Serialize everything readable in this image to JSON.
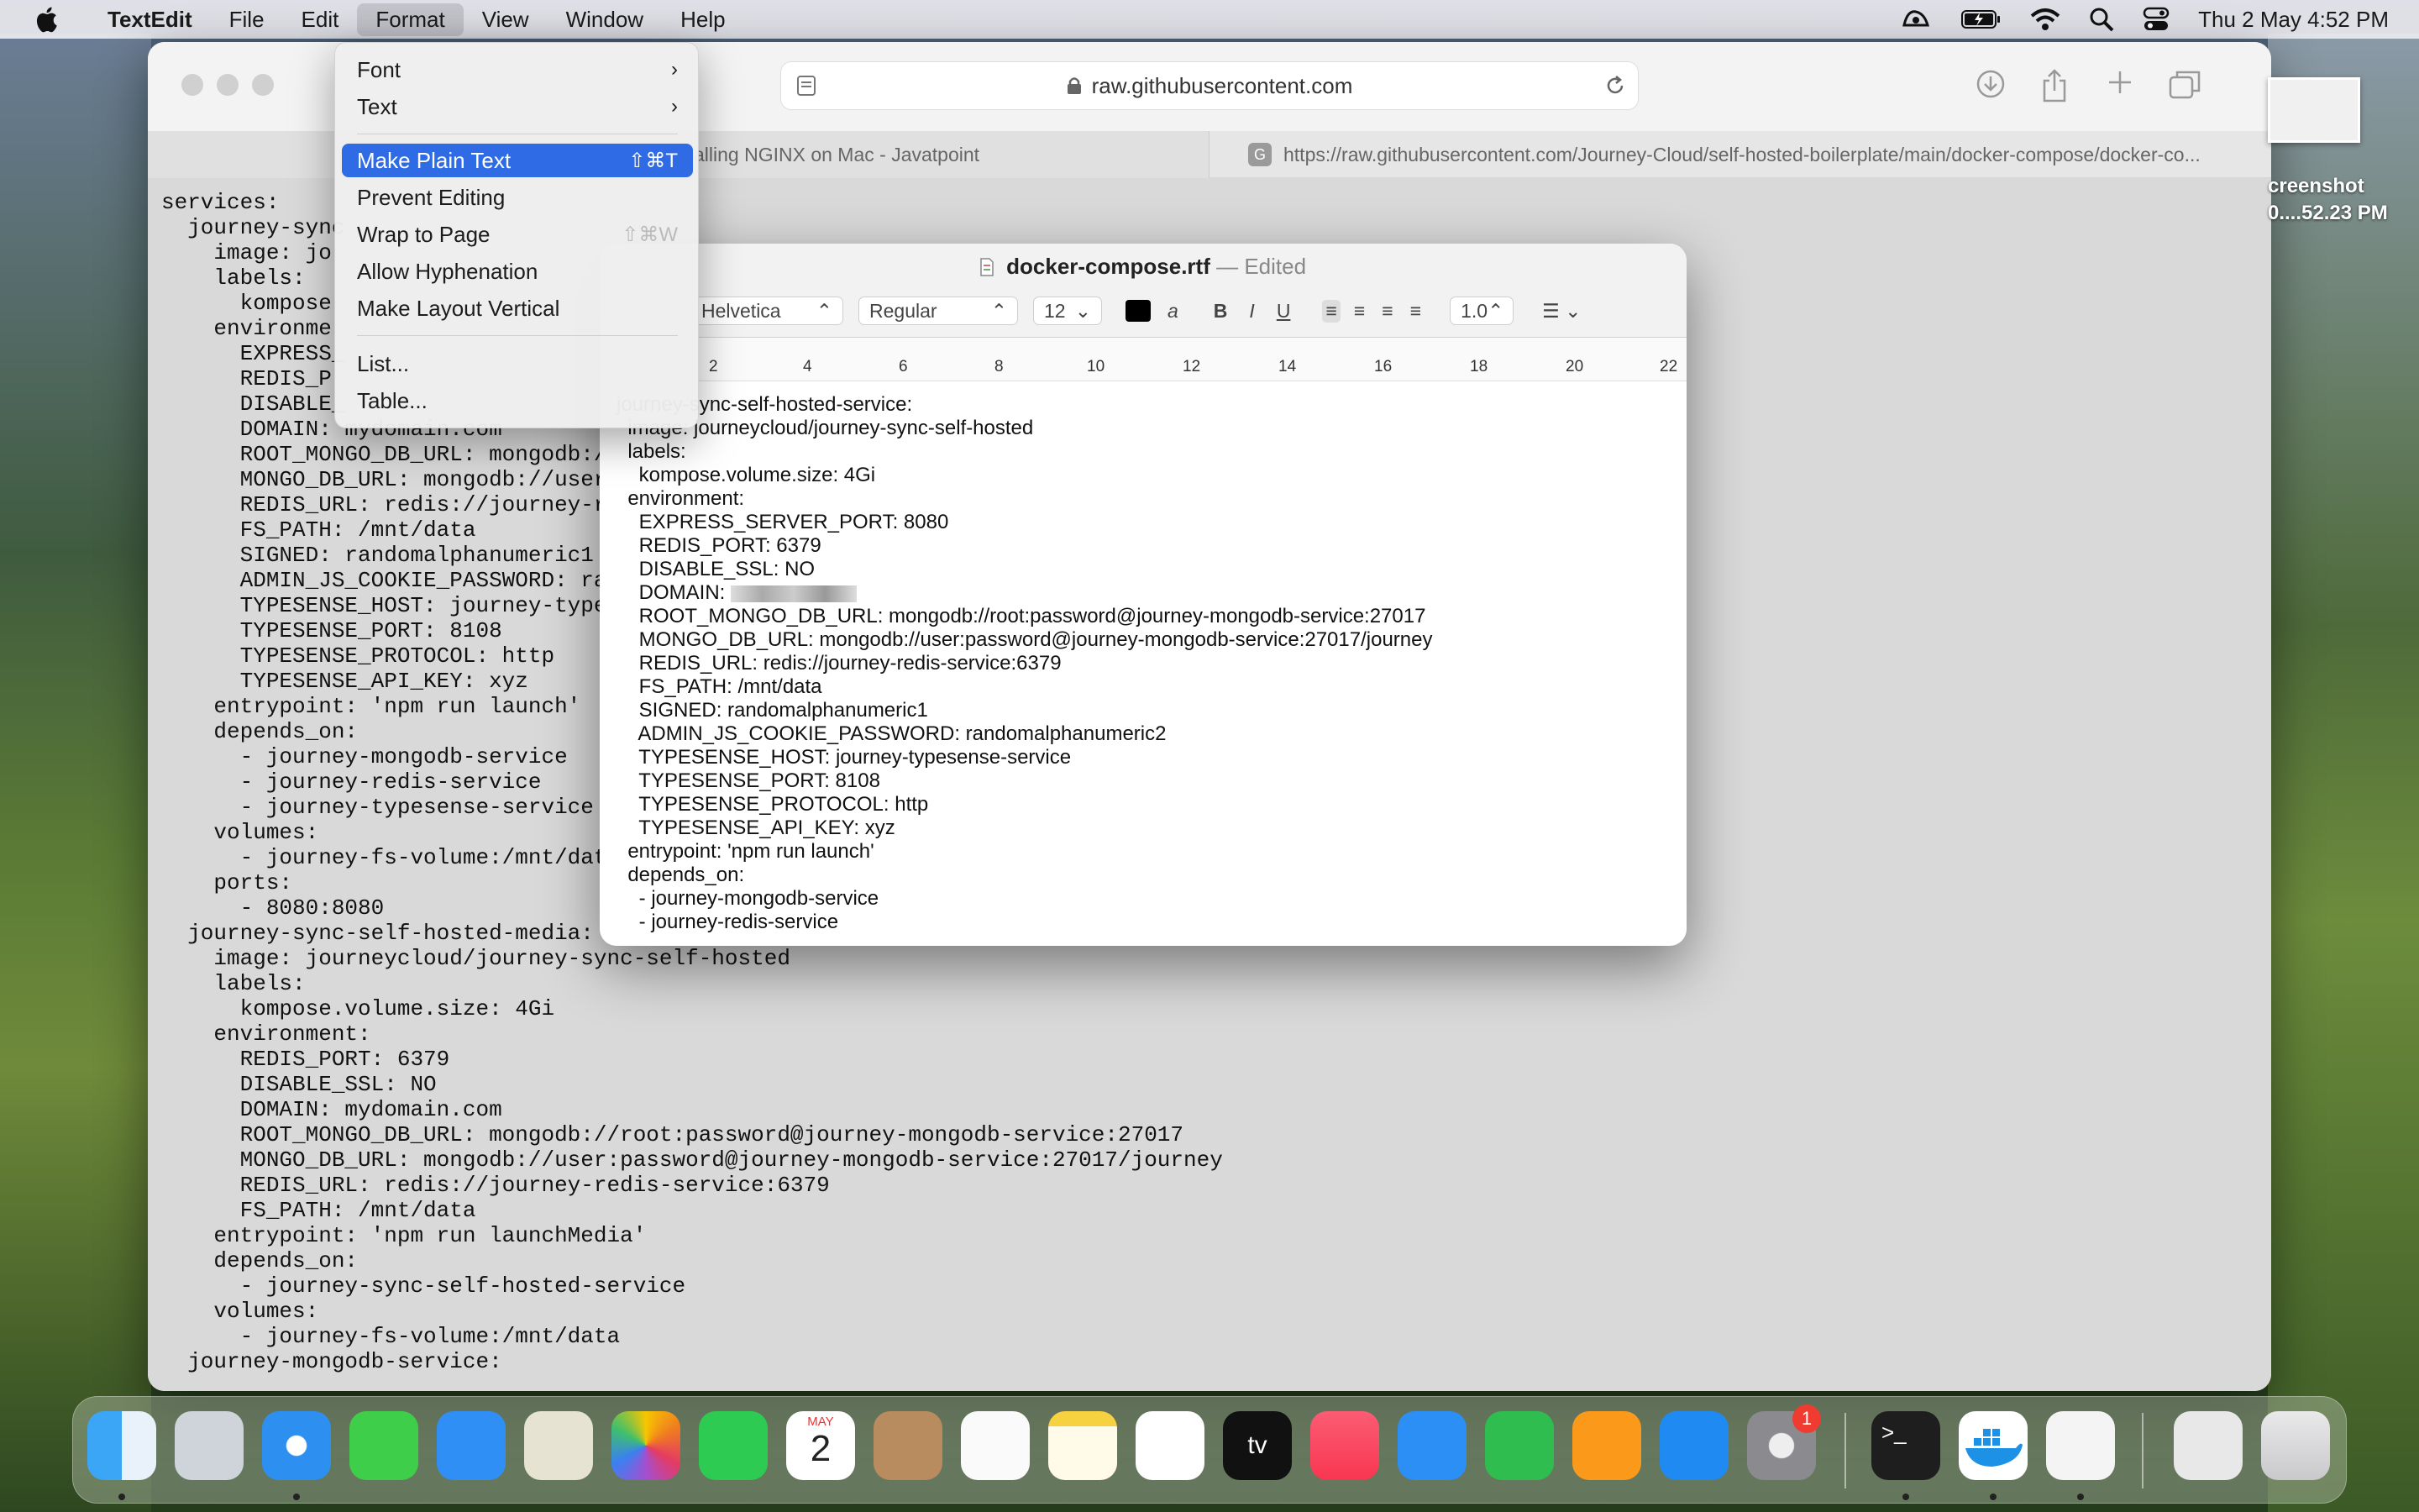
{
  "menubar": {
    "app": "TextEdit",
    "items": [
      "File",
      "Edit",
      "Format",
      "View",
      "Window",
      "Help"
    ],
    "clock": "Thu 2 May  4:52 PM",
    "icons": [
      "apple-icon",
      "dictation-icon",
      "battery-icon",
      "wifi-icon",
      "search-icon",
      "control-center-icon"
    ]
  },
  "safari": {
    "url": "raw.githubusercontent.com",
    "tab1": "alling NGINX on Mac - Javatpoint",
    "tab2_favicon": "G",
    "tab2": "https://raw.githubusercontent.com/Journey-Cloud/self-hosted-boilerplate/main/docker-compose/docker-co...",
    "content": "services:\n  journey-sync\n    image: jo\n    labels:\n      kompose\n    environme\n      EXPRESS_\n      REDIS_P\n      DISABLE_\n      DOMAIN: mydomain.com\n      ROOT_MONGO_DB_URL: mongodb:/\n      MONGO_DB_URL: mongodb://user\n      REDIS_URL: redis://journey-r\n      FS_PATH: /mnt/data\n      SIGNED: randomalphanumeric1\n      ADMIN_JS_COOKIE_PASSWORD: ra\n      TYPESENSE_HOST: journey-type\n      TYPESENSE_PORT: 8108\n      TYPESENSE_PROTOCOL: http\n      TYPESENSE_API_KEY: xyz\n    entrypoint: 'npm run launch'\n    depends_on:\n      - journey-mongodb-service\n      - journey-redis-service\n      - journey-typesense-service\n    volumes:\n      - journey-fs-volume:/mnt/data\n    ports:\n      - 8080:8080\n  journey-sync-self-hosted-media:\n    image: journeycloud/journey-sync-self-hosted\n    labels:\n      kompose.volume.size: 4Gi\n    environment:\n      REDIS_PORT: 6379\n      DISABLE_SSL: NO\n      DOMAIN: mydomain.com\n      ROOT_MONGO_DB_URL: mongodb://root:password@journey-mongodb-service:27017\n      MONGO_DB_URL: mongodb://user:password@journey-mongodb-service:27017/journey\n      REDIS_URL: redis://journey-redis-service:6379\n      FS_PATH: /mnt/data\n    entrypoint: 'npm run launchMedia'\n    depends_on:\n      - journey-sync-self-hosted-service\n    volumes:\n      - journey-fs-volume:/mnt/data\n  journey-mongodb-service:"
  },
  "desktop": {
    "file_label_1": "creenshot",
    "file_label_2": "0....52.23 PM"
  },
  "textedit": {
    "filename": "docker-compose.rtf",
    "dash": "—",
    "status": "Edited",
    "font": "Helvetica",
    "style": "Regular",
    "size": "12",
    "spacing": "1.0",
    "bold": "B",
    "italic": "I",
    "underline": "U",
    "ruler": [
      "2",
      "4",
      "6",
      "8",
      "10",
      "12",
      "14",
      "16",
      "18",
      "20",
      "22"
    ],
    "line0": "journey-sync-self-hosted-service:",
    "domain_label": "    DOMAIN: ",
    "before_domain": "  image: journeycloud/journey-sync-self-hosted\n  labels:\n    kompose.volume.size: 4Gi\n  environment:\n    EXPRESS_SERVER_PORT: 8080\n    REDIS_PORT: 6379\n    DISABLE_SSL: NO",
    "after_domain": "    ROOT_MONGO_DB_URL: mongodb://root:password@journey-mongodb-service:27017\n    MONGO_DB_URL: mongodb://user:password@journey-mongodb-service:27017/journey\n    REDIS_URL: redis://journey-redis-service:6379\n    FS_PATH: /mnt/data\n    SIGNED: randomalphanumeric1\n    ADMIN_JS_COOKIE_PASSWORD: randomalphanumeric2\n    TYPESENSE_HOST: journey-typesense-service\n    TYPESENSE_PORT: 8108\n    TYPESENSE_PROTOCOL: http\n    TYPESENSE_API_KEY: xyz\n  entrypoint: 'npm run launch'\n  depends_on:\n    - journey-mongodb-service\n    - journey-redis-service"
  },
  "format_menu": {
    "font": "Font",
    "text": "Text",
    "make_plain": "Make Plain Text",
    "make_plain_sc": "⇧⌘T",
    "prevent": "Prevent Editing",
    "wrap": "Wrap to Page",
    "wrap_sc": "⇧⌘W",
    "hyphen": "Allow Hyphenation",
    "vertical": "Make Layout Vertical",
    "list": "List...",
    "table": "Table..."
  },
  "dock": {
    "calendar_month": "MAY",
    "calendar_day": "2",
    "settings_badge": "1",
    "apps": [
      "finder",
      "launchpad",
      "safari",
      "messages",
      "mail",
      "maps",
      "photos",
      "facetime",
      "calendar",
      "contacts",
      "reminders",
      "notes",
      "freeform",
      "tv",
      "music",
      "keynote",
      "numbers",
      "pages",
      "app-store",
      "system-settings",
      "terminal",
      "docker",
      "textedit",
      "preview",
      "trash"
    ]
  }
}
